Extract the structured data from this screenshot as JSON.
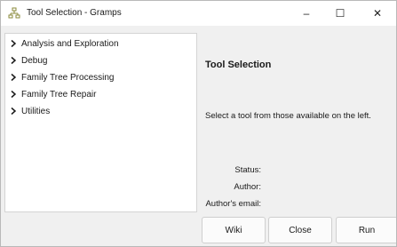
{
  "window": {
    "title": "Tool Selection - Gramps"
  },
  "controls": {
    "minimize": "–",
    "maximize": "☐",
    "close": "✕"
  },
  "tree": {
    "items": [
      {
        "label": "Analysis and Exploration"
      },
      {
        "label": "Debug"
      },
      {
        "label": "Family Tree Processing"
      },
      {
        "label": "Family Tree Repair"
      },
      {
        "label": "Utilities"
      }
    ]
  },
  "pane": {
    "title": "Tool Selection",
    "description": "Select a tool from those available on the left.",
    "status_label": "Status:",
    "author_label": "Author:",
    "email_label": "Author's email:"
  },
  "buttons": {
    "wiki": "Wiki",
    "close": "Close",
    "run": "Run"
  },
  "icons": {
    "app": "gramps-tree-icon",
    "expander": "chevron-right-icon"
  }
}
